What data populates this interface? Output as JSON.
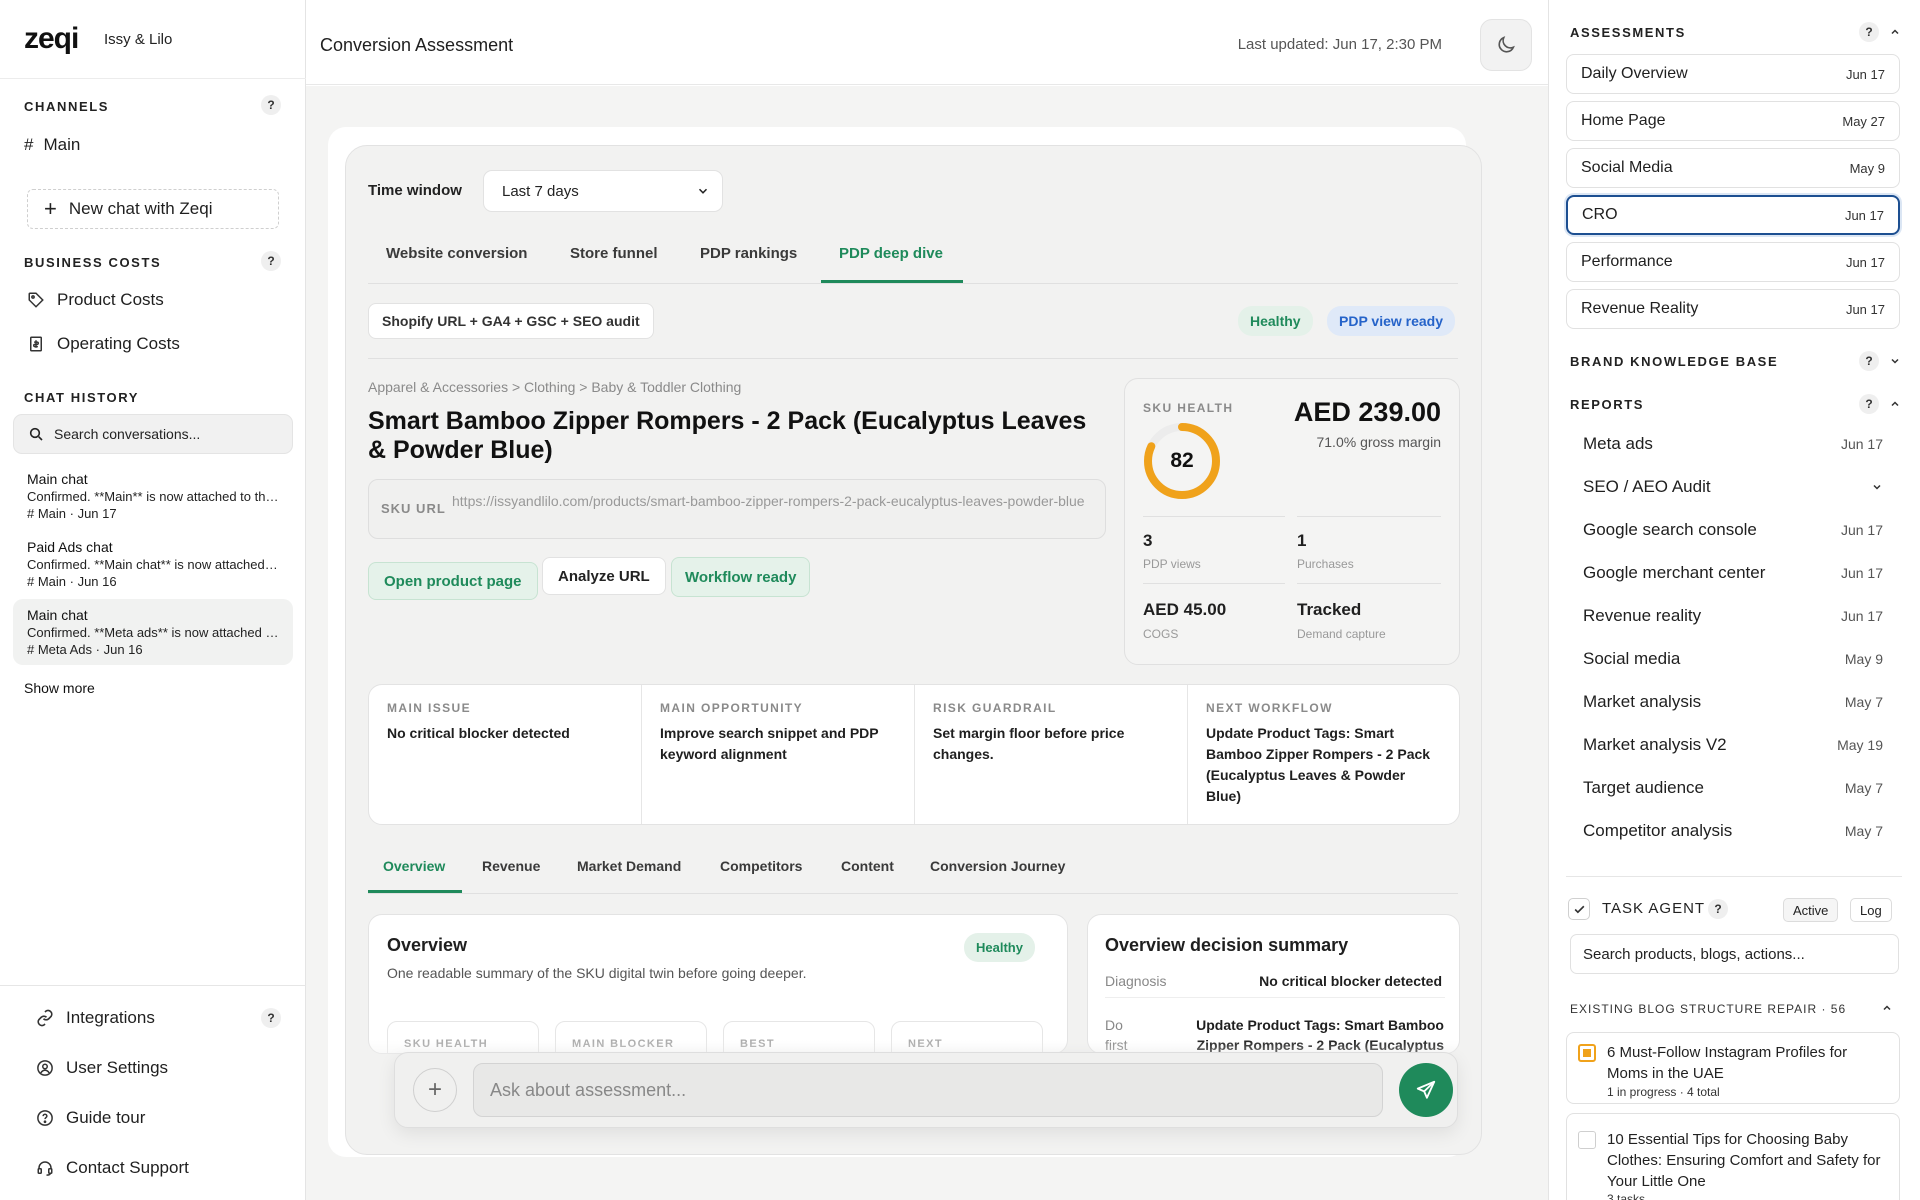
{
  "left": {
    "logo": "zeqi",
    "brand": "Issy & Lilo",
    "channels_title": "CHANNELS",
    "channel_main": "Main",
    "new_chat": "New chat with Zeqi",
    "business_costs_title": "BUSINESS COSTS",
    "product_costs": "Product Costs",
    "operating_costs": "Operating Costs",
    "chat_history_title": "CHAT HISTORY",
    "search_placeholder": "Search conversations...",
    "chats": [
      {
        "title": "Main chat",
        "preview": "Confirmed. **Main** is now attached to the chat.",
        "meta": "# Main · Jun 17"
      },
      {
        "title": "Paid Ads chat",
        "preview": "Confirmed. **Main chat** is now attached to the chat.",
        "meta": "# Main · Jun 16"
      },
      {
        "title": "Main chat",
        "preview": "Confirmed. **Meta ads** is now attached to the chat.",
        "meta": "# Meta Ads · Jun 16"
      }
    ],
    "show_more": "Show more",
    "integrations": "Integrations",
    "user_settings": "User Settings",
    "guide_tour": "Guide tour",
    "contact_support": "Contact Support",
    "help": "?"
  },
  "header": {
    "title": "Conversion Assessment",
    "last_updated": "Last updated: Jun 17, 2:30 PM"
  },
  "main": {
    "time_window_label": "Time window",
    "time_window_value": "Last 7 days",
    "tabs": [
      "Website conversion",
      "Store funnel",
      "PDP rankings",
      "PDP deep dive"
    ],
    "source_chip": "Shopify URL + GA4 + GSC + SEO audit",
    "status_healthy": "Healthy",
    "status_pdp": "PDP view ready",
    "breadcrumb": "Apparel & Accessories > Clothing > Baby & Toddler Clothing",
    "product_title": "Smart Bamboo Zipper Rompers - 2 Pack (Eucalyptus Leaves & Powder Blue)",
    "sku_url_label": "SKU URL",
    "sku_url": "https://issyandlilo.com/products/smart-bamboo-zipper-rompers-2-pack-eucalyptus-leaves-powder-blue",
    "btn_open": "Open product page",
    "btn_analyze": "Analyze URL",
    "btn_workflow": "Workflow ready",
    "sku_health_label": "SKU HEALTH",
    "sku_score": "82",
    "sku_score_fraction": 0.82,
    "price": "AED 239.00",
    "margin": "71.0% gross margin",
    "stats": [
      {
        "value": "3",
        "label": "PDP views"
      },
      {
        "value": "1",
        "label": "Purchases"
      },
      {
        "value": "AED 45.00",
        "label": "COGS"
      },
      {
        "value": "Tracked",
        "label": "Demand capture"
      }
    ],
    "summary": [
      {
        "label": "MAIN ISSUE",
        "text": "No critical blocker detected"
      },
      {
        "label": "MAIN OPPORTUNITY",
        "text": "Improve search snippet and PDP keyword alignment"
      },
      {
        "label": "RISK GUARDRAIL",
        "text": "Set margin floor before price changes."
      },
      {
        "label": "NEXT WORKFLOW",
        "text": "Update Product Tags: Smart Bamboo Zipper Rompers - 2 Pack (Eucalyptus Leaves & Powder Blue)"
      }
    ],
    "subtabs": [
      "Overview",
      "Revenue",
      "Market Demand",
      "Competitors",
      "Content",
      "Conversion Journey"
    ],
    "overview_title": "Overview",
    "overview_sub": "One readable summary of the SKU digital twin before going deeper.",
    "overview_badge": "Healthy",
    "mini_cards": [
      "SKU HEALTH",
      "MAIN BLOCKER",
      "BEST",
      "NEXT"
    ],
    "decision_title": "Overview decision summary",
    "diagnosis_label": "Diagnosis",
    "diagnosis_value": "No critical blocker detected",
    "dofirst_label": "Do first",
    "dofirst_value": "Update Product Tags: Smart Bamboo Zipper Rompers - 2 Pack (Eucalyptus",
    "ask_placeholder": "Ask about assessment..."
  },
  "right": {
    "assessments_title": "ASSESSMENTS",
    "assessments": [
      {
        "name": "Daily Overview",
        "date": "Jun 17"
      },
      {
        "name": "Home Page",
        "date": "May 27"
      },
      {
        "name": "Social Media",
        "date": "May 9"
      },
      {
        "name": "CRO",
        "date": "Jun 17"
      },
      {
        "name": "Performance",
        "date": "Jun 17"
      },
      {
        "name": "Revenue Reality",
        "date": "Jun 17"
      }
    ],
    "kb_title": "BRAND KNOWLEDGE BASE",
    "reports_title": "REPORTS",
    "reports": [
      {
        "name": "Meta ads",
        "date": "Jun 17"
      },
      {
        "name": "SEO / AEO Audit",
        "date": ""
      },
      {
        "name": "Google search console",
        "date": "Jun 17"
      },
      {
        "name": "Google merchant center",
        "date": "Jun 17"
      },
      {
        "name": "Revenue reality",
        "date": "Jun 17"
      },
      {
        "name": "Social media",
        "date": "May 9"
      },
      {
        "name": "Market analysis",
        "date": "May 7"
      },
      {
        "name": "Market analysis V2",
        "date": "May 19"
      },
      {
        "name": "Target audience",
        "date": "May 7"
      },
      {
        "name": "Competitor analysis",
        "date": "May 7"
      }
    ],
    "task_agent": "TASK AGENT",
    "active": "Active",
    "log": "Log",
    "task_search": "Search products, blogs, actions...",
    "blog_repair": "EXISTING BLOG STRUCTURE REPAIR · 56",
    "tasks": [
      {
        "title": "6 Must-Follow Instagram Profiles for Moms in the UAE",
        "meta": "1 in progress · 4 total"
      },
      {
        "title": "10 Essential Tips for Choosing Baby Clothes: Ensuring Comfort and Safety for Your Little One",
        "meta": "3 tasks"
      }
    ]
  },
  "colors": {
    "accent": "#1f8a5b",
    "ring": "#f0a21b",
    "blue": "#2563c9",
    "selected_border": "#1d4f91"
  }
}
